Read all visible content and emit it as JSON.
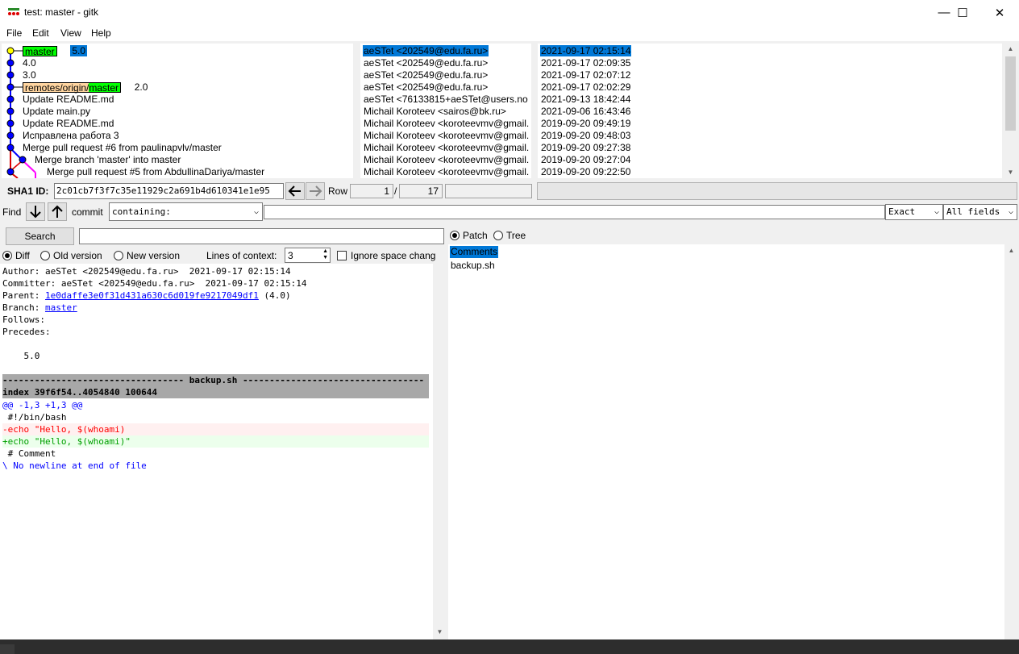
{
  "window": {
    "title": "test: master - gitk",
    "minimize": "—",
    "maximize": "☐",
    "close": "✕"
  },
  "menu": [
    "File",
    "Edit",
    "View",
    "Help"
  ],
  "commits": [
    {
      "tags": [
        {
          "text": "master",
          "style": "green"
        },
        {
          "text": "5.0",
          "style": "sel"
        }
      ],
      "subject": "",
      "author": "aeSTet <202549@edu.fa.ru>",
      "date": "2021-09-17 02:15:14",
      "selected": true
    },
    {
      "tags": [],
      "subject": "4.0",
      "author": "aeSTet <202549@edu.fa.ru>",
      "date": "2021-09-17 02:09:35"
    },
    {
      "tags": [],
      "subject": "3.0",
      "author": "aeSTet <202549@edu.fa.ru>",
      "date": "2021-09-17 02:07:12"
    },
    {
      "tags": [
        {
          "text": "remotes/origin/",
          "style": "orange"
        },
        {
          "text": "master",
          "style": "green"
        }
      ],
      "subject": "2.0",
      "author": "aeSTet <202549@edu.fa.ru>",
      "date": "2021-09-17 02:02:29"
    },
    {
      "tags": [],
      "subject": "Update README.md",
      "author": "aeSTet <76133815+aeSTet@users.no",
      "date": "2021-09-13 18:42:44"
    },
    {
      "tags": [],
      "subject": "Update main.py",
      "author": "Michail Koroteev <sairos@bk.ru>",
      "date": "2021-09-06 16:43:46"
    },
    {
      "tags": [],
      "subject": "Update README.md",
      "author": "Michail Koroteev <koroteevmv@gmail.",
      "date": "2019-09-20 09:49:19"
    },
    {
      "tags": [],
      "subject": "Исправлена работа 3",
      "author": "Michail Koroteev <koroteevmv@gmail.",
      "date": "2019-09-20 09:48:03"
    },
    {
      "tags": [],
      "subject": "Merge pull request #6 from paulinapvlv/master",
      "author": "Michail Koroteev <koroteevmv@gmail.",
      "date": "2019-09-20 09:27:38"
    },
    {
      "tags": [],
      "subject": "Merge branch 'master' into master",
      "author": "Michail Koroteev <koroteevmv@gmail.",
      "date": "2019-09-20 09:27:04"
    },
    {
      "tags": [],
      "subject": "Merge pull request #5 from AbdullinaDariya/master",
      "author": "Michail Koroteev <koroteevmv@gmail.",
      "date": "2019-09-20 09:22:50"
    }
  ],
  "sha": {
    "label": "SHA1 ID:",
    "value": "2c01cb7f3f7c35e11929c2a691b4d610341e1e95",
    "row_label": "Row",
    "row_current": "1",
    "row_sep": "/",
    "row_total": "17"
  },
  "find": {
    "label": "Find",
    "type_label": "commit",
    "mode": "containing:",
    "match": "Exact",
    "fields": "All fields",
    "search_button": "Search"
  },
  "diff_options": {
    "diff": "Diff",
    "old_version": "Old version",
    "new_version": "New version",
    "context_label": "Lines of context:",
    "context_value": "3",
    "ignore_space": "Ignore space chang"
  },
  "tree_options": {
    "patch": "Patch",
    "tree": "Tree"
  },
  "files": [
    "Comments",
    "backup.sh"
  ],
  "details": {
    "author": "Author: aeSTet <202549@edu.fa.ru>  2021-09-17 02:15:14",
    "committer": "Committer: aeSTet <202549@edu.fa.ru>  2021-09-17 02:15:14",
    "parent_label": "Parent: ",
    "parent_sha": "1e0daffe3e0f31d431a630c6d019fe9217049df1",
    "parent_tag": " (4.0)",
    "branch_label": "Branch: ",
    "branch": "master",
    "follows": "Follows:",
    "precedes": "Precedes:",
    "precedes_value": "    5.0",
    "file_header": "---------------------------------- backup.sh ----------------------------------",
    "index": "index 39f6f54..4054840 100644",
    "hunk": "@@ -1,3 +1,3 @@",
    "l1": " #!/bin/bash",
    "l2": "-echo \"Hello, $(whoami)",
    "l3": "+echo \"Hello, $(whoami)\"",
    "l4": " # Comment",
    "l5": "\\ No newline at end of file"
  }
}
